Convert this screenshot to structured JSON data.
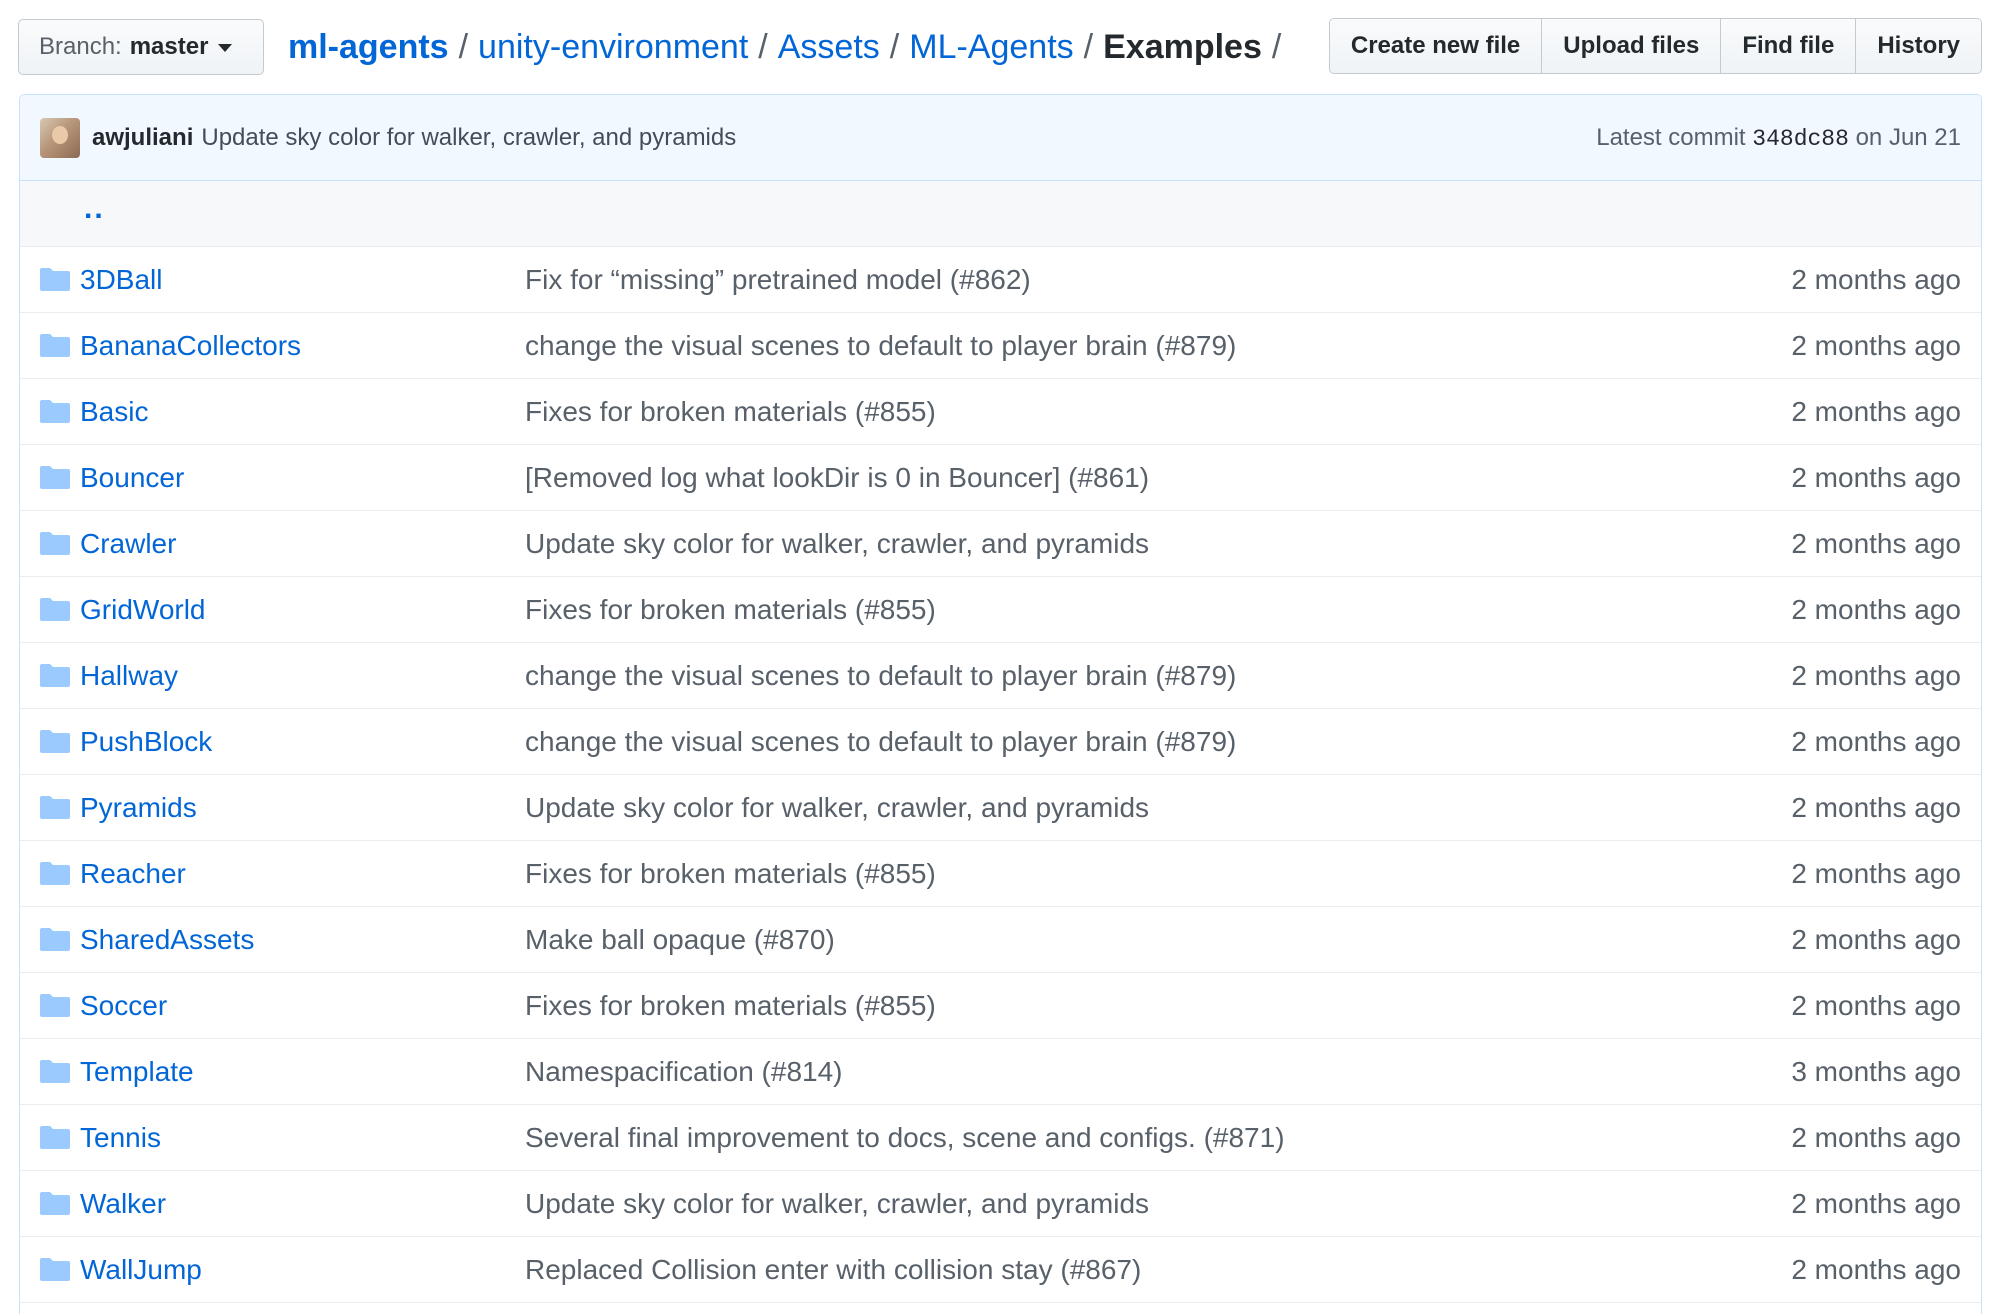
{
  "branch": {
    "label": "Branch:",
    "name": "master"
  },
  "breadcrumb": {
    "repo": "ml-agents",
    "path": [
      "unity-environment",
      "Assets",
      "ML-Agents"
    ],
    "current": "Examples",
    "separator": "/"
  },
  "actions": {
    "create": "Create new file",
    "upload": "Upload files",
    "find": "Find file",
    "history": "History"
  },
  "commit": {
    "author": "awjuliani",
    "message": "Update sky color for walker, crawler, and pyramids",
    "latest_label": "Latest commit",
    "sha": "348dc88",
    "date": "on Jun 21"
  },
  "parent_link": "..",
  "files": [
    {
      "name": "3DBall",
      "message": "Fix for “missing” pretrained model (#862)",
      "age": "2 months ago"
    },
    {
      "name": "BananaCollectors",
      "message": "change the visual scenes to default to player brain (#879)",
      "age": "2 months ago"
    },
    {
      "name": "Basic",
      "message": "Fixes for broken materials (#855)",
      "age": "2 months ago"
    },
    {
      "name": "Bouncer",
      "message": "[Removed log what lookDir is 0 in Bouncer] (#861)",
      "age": "2 months ago"
    },
    {
      "name": "Crawler",
      "message": "Update sky color for walker, crawler, and pyramids",
      "age": "2 months ago"
    },
    {
      "name": "GridWorld",
      "message": "Fixes for broken materials (#855)",
      "age": "2 months ago"
    },
    {
      "name": "Hallway",
      "message": "change the visual scenes to default to player brain (#879)",
      "age": "2 months ago"
    },
    {
      "name": "PushBlock",
      "message": "change the visual scenes to default to player brain (#879)",
      "age": "2 months ago"
    },
    {
      "name": "Pyramids",
      "message": "Update sky color for walker, crawler, and pyramids",
      "age": "2 months ago"
    },
    {
      "name": "Reacher",
      "message": "Fixes for broken materials (#855)",
      "age": "2 months ago"
    },
    {
      "name": "SharedAssets",
      "message": "Make ball opaque (#870)",
      "age": "2 months ago"
    },
    {
      "name": "Soccer",
      "message": "Fixes for broken materials (#855)",
      "age": "2 months ago"
    },
    {
      "name": "Template",
      "message": "Namespacification (#814)",
      "age": "3 months ago"
    },
    {
      "name": "Tennis",
      "message": "Several final improvement to docs, scene and configs. (#871)",
      "age": "2 months ago"
    },
    {
      "name": "Walker",
      "message": "Update sky color for walker, crawler, and pyramids",
      "age": "2 months ago"
    },
    {
      "name": "WallJump",
      "message": "Replaced Collision enter with collision stay (#867)",
      "age": "2 months ago"
    }
  ],
  "colors": {
    "link": "#0366d6",
    "muted": "#586069",
    "commit_bg": "#f1f8ff",
    "folder": "#79b8ff"
  }
}
